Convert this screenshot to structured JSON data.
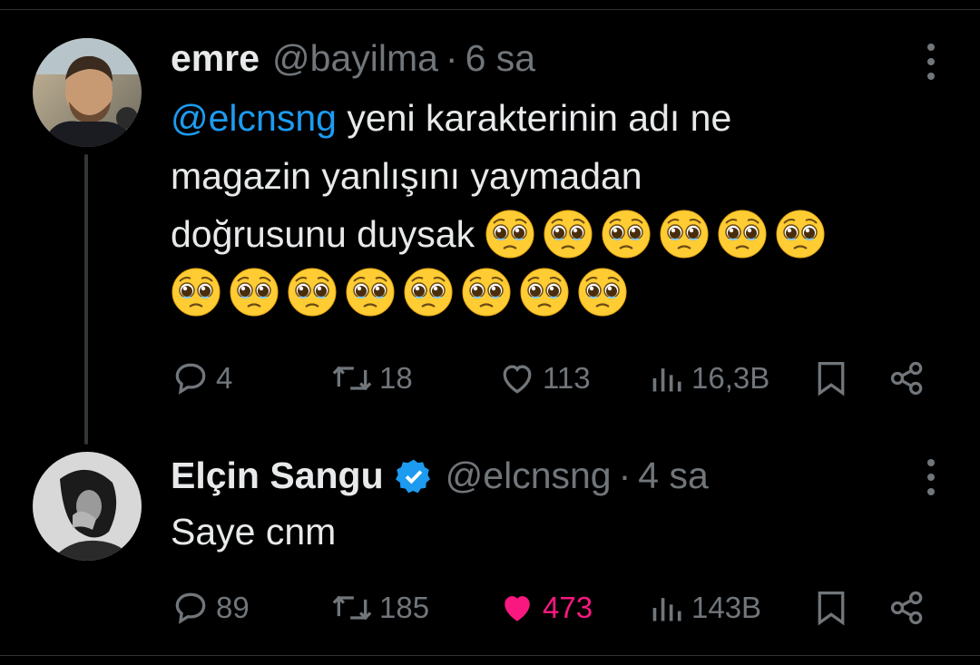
{
  "tweets": [
    {
      "name": "emre",
      "handle": "@bayilma",
      "separator": "·",
      "time": "6 sa",
      "mention": "@elcnsng",
      "text_line1": " yeni karakterinin adı ne",
      "text_line2": "magazin yanlışını yaymadan",
      "text_line3": "doğrusunu duysak",
      "emoji_icon": "pleading-face-emoji",
      "emoji_count_line3": 6,
      "emoji_count_line4": 8,
      "replies": "4",
      "retweets": "18",
      "likes": "113",
      "views": "16,3B"
    },
    {
      "name": "Elçin Sangu",
      "verified_color": "#1d9bf0",
      "handle": "@elcnsng",
      "separator": "·",
      "time": "4 sa",
      "text": "Saye cnm",
      "replies": "89",
      "retweets": "185",
      "likes": "473",
      "like_color": "#f91880",
      "views": "143B"
    }
  ],
  "colors": {
    "accent": "#1d9bf0",
    "muted": "#71767b",
    "text": "#e7e9ea",
    "background": "#000000"
  }
}
